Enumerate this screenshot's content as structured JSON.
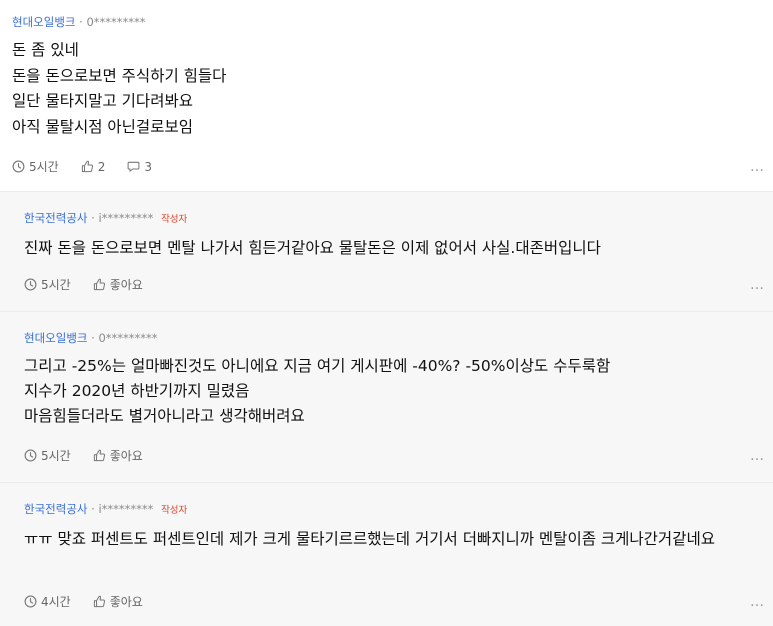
{
  "comments": [
    {
      "author": "현대오일뱅크",
      "separator": "·",
      "user_id": "0*********",
      "badge": "",
      "lines": [
        "돈 좀 있네",
        "돈을 돈으로보면 주식하기 힘들다",
        "일단 물타지말고 기다려봐요",
        "아직 물탈시점 아닌걸로보임"
      ],
      "time": "5시간",
      "likes": "2",
      "replies": "3",
      "more": "…"
    },
    {
      "author": "한국전력공사",
      "separator": "·",
      "user_id": "i*********",
      "badge": "작성자",
      "lines": [
        "진짜 돈을 돈으로보면 멘탈 나가서 힘든거같아요 물탈돈은 이제 없어서 사실.대존버입니다"
      ],
      "time": "5시간",
      "like_label": "좋아요",
      "more": "…"
    },
    {
      "author": "현대오일뱅크",
      "separator": "·",
      "user_id": "0*********",
      "badge": "",
      "lines": [
        "그리고 -25%는 얼마빠진것도 아니에요 지금 여기 게시판에 -40%? -50%이상도 수두룩함",
        "지수가 2020년 하반기까지 밀렸음",
        "마음힘들더라도 별거아니라고 생각해버려요"
      ],
      "time": "5시간",
      "like_label": "좋아요",
      "more": "…"
    },
    {
      "author": "한국전력공사",
      "separator": "·",
      "user_id": "i*********",
      "badge": "작성자",
      "lines": [
        "ㅠㅠ 맞죠 퍼센트도 퍼센트인데 제가 크게 물타기르르했는데 거기서 더빠지니까 멘탈이좀 크게나간거같네요"
      ],
      "time": "4시간",
      "like_label": "좋아요",
      "more": "…"
    }
  ],
  "colors": {
    "author": "#3a6fd8",
    "badge": "#d9442b",
    "reply_background": "#f7f7f7",
    "meta_gray": "#8a8a8a"
  },
  "icons": [
    "clock-icon",
    "thumbs-up-icon",
    "speech-bubble-icon",
    "more-options-icon"
  ]
}
